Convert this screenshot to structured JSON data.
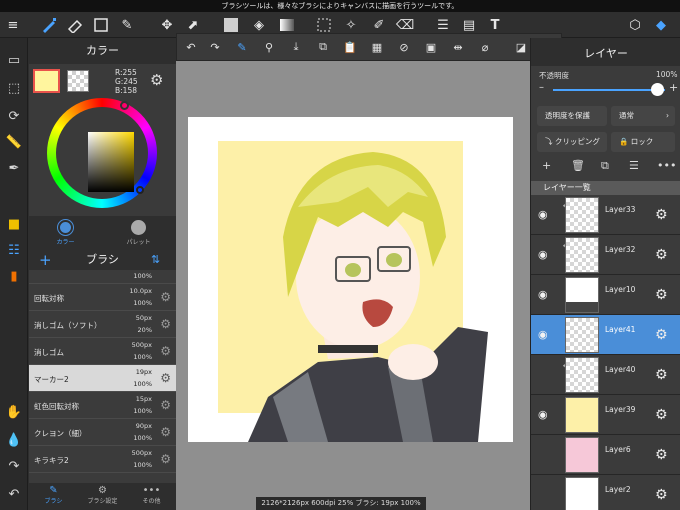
{
  "top_message": "ブラシツールは、様々なブラシによりキャンバスに描画を行うツールです。",
  "colors": {
    "main_color": "#fff59e",
    "accent_blue": "#4a8ed8"
  },
  "color_panel": {
    "title": "カラー",
    "rgb": "R:255\nG:245\nB:158",
    "tabs": [
      "カラー",
      "パレット"
    ]
  },
  "brush_panel": {
    "title": "ブラシ",
    "items": [
      {
        "name": "",
        "size": "",
        "opacity": "100%"
      },
      {
        "name": "回転対称",
        "size": "10.0px",
        "opacity": "100%"
      },
      {
        "name": "消しゴム（ソフト）",
        "size": "50px",
        "opacity": "20%"
      },
      {
        "name": "消しゴム",
        "size": "500px",
        "opacity": "100%"
      },
      {
        "name": "マーカー2",
        "size": "19px",
        "opacity": "100%"
      },
      {
        "name": "虹色回転対称",
        "size": "15px",
        "opacity": "100%"
      },
      {
        "name": "クレヨン（細）",
        "size": "90px",
        "opacity": "100%"
      },
      {
        "name": "キラキラ2",
        "size": "500px",
        "opacity": "100%"
      }
    ],
    "tabs": [
      "ブラシ",
      "ブラシ設定",
      "その他"
    ]
  },
  "status_bar": "2126*2126px 600dpi 25% ブラシ: 19px 100%",
  "layer_panel": {
    "title": "レイヤー",
    "opacity_label": "不透明度",
    "opacity_value": "100%",
    "protect_label": "透明度を保護",
    "blend_mode": "通常",
    "clipping_label": "クリッピング",
    "lock_label": "ロック",
    "list_header": "レイヤー一覧",
    "layers": [
      {
        "name": "Layer33",
        "visible": true,
        "clipped": true,
        "selected": false
      },
      {
        "name": "Layer32",
        "visible": true,
        "clipped": true,
        "selected": false
      },
      {
        "name": "Layer10",
        "visible": true,
        "clipped": false,
        "selected": false
      },
      {
        "name": "Layer41",
        "visible": true,
        "clipped": false,
        "selected": true
      },
      {
        "name": "Layer40",
        "visible": false,
        "clipped": true,
        "selected": false
      },
      {
        "name": "Layer39",
        "visible": true,
        "clipped": false,
        "selected": false
      },
      {
        "name": "Layer6",
        "visible": false,
        "clipped": false,
        "selected": false
      },
      {
        "name": "Layer2",
        "visible": false,
        "clipped": false,
        "selected": false
      }
    ]
  },
  "icons": {
    "top_toolbar": [
      "menu-icon",
      "brush-icon",
      "eraser-icon",
      "rectangle-icon",
      "color-pick-icon",
      "move-icon",
      "transform-icon",
      "fill-color-icon",
      "bucket-icon",
      "gradient-icon",
      "select-icon",
      "magic-wand-icon",
      "select-pen-icon",
      "select-eraser-icon",
      "layout-icon",
      "text-icon",
      "materials-icon",
      "layers-icon"
    ],
    "sub_toolbar": [
      "undo-icon",
      "redo-icon",
      "brush-settings-icon",
      "eyedropper-icon",
      "save-icon",
      "copy-icon",
      "paste-icon",
      "grid-icon",
      "clear-icon",
      "fill-icon",
      "flip-icon",
      "snap-off-icon",
      "ruler-icon",
      "more-icon"
    ]
  }
}
